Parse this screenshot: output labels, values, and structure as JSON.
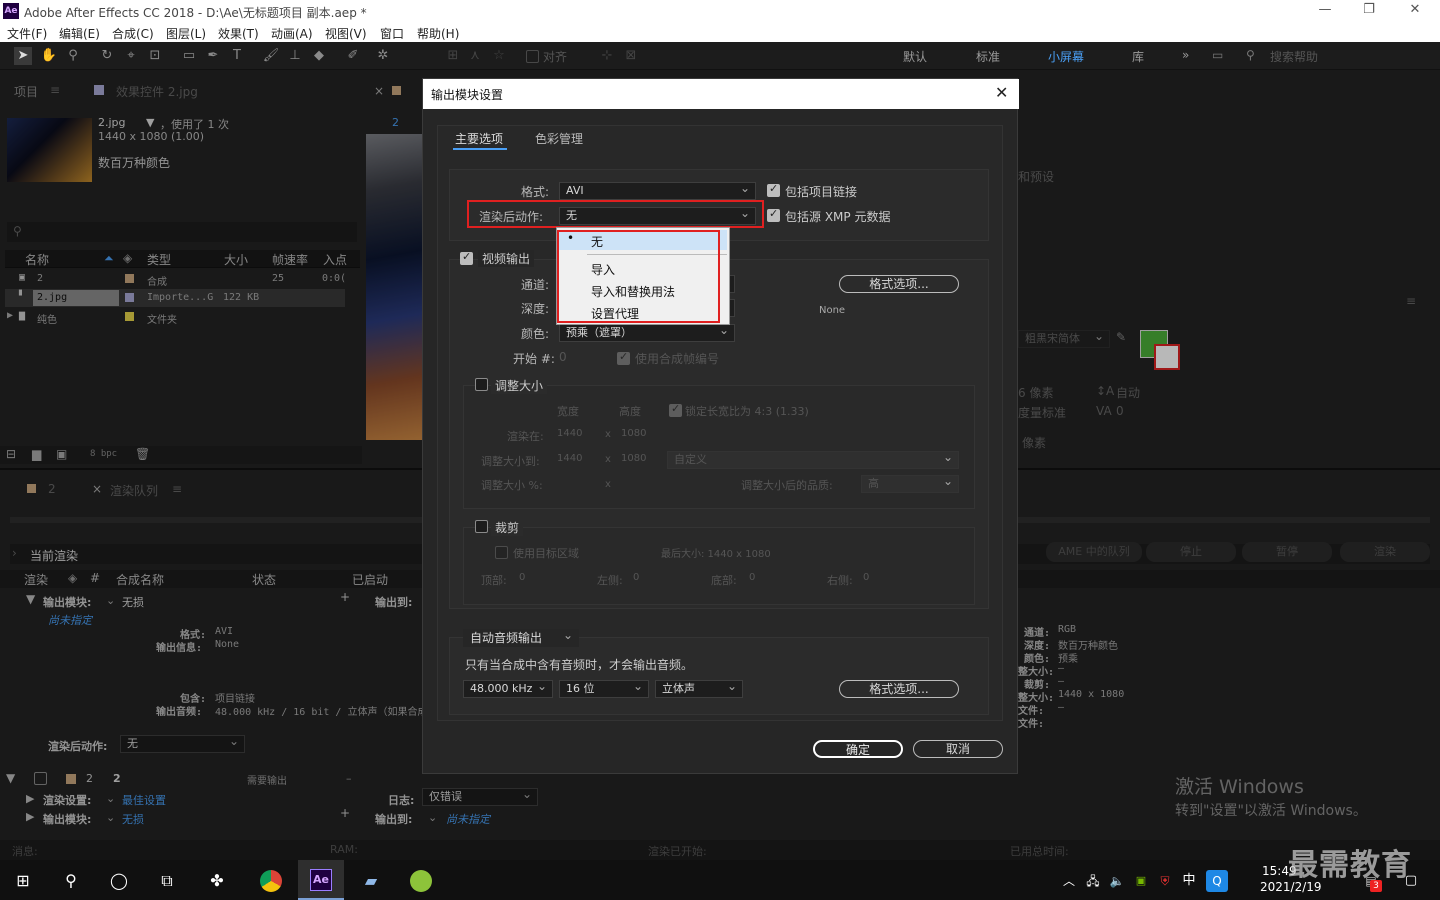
{
  "window": {
    "title": "Adobe After Effects CC 2018 - D:\\Ae\\无标题项目 副本.aep *",
    "app_icon": "Ae",
    "controls": [
      "—",
      "❐",
      "✕"
    ]
  },
  "menu": [
    "文件(F)",
    "编辑(E)",
    "合成(C)",
    "图层(L)",
    "效果(T)",
    "动画(A)",
    "视图(V)",
    "窗口",
    "帮助(H)"
  ],
  "toolbar": {
    "align_label": "对齐",
    "workspaces": [
      "默认",
      "标准",
      "小屏幕",
      "库"
    ],
    "active_workspace": "小屏幕",
    "search_placeholder": "搜索帮助",
    "more": "»"
  },
  "project_panel": {
    "tab_project": "项目",
    "tab_effects": "效果控件 2.jpg",
    "asset_name": "2.jpg",
    "asset_used": "，使用了 1 次",
    "asset_dims": "1440 x 1080 (1.00)",
    "asset_colors": "数百万种颜色",
    "columns": [
      "名称",
      "类型",
      "大小",
      "帧速率",
      "入点"
    ],
    "rows": [
      {
        "name": "2",
        "type": "合成",
        "size": "",
        "fps": "25",
        "in": "0:0("
      },
      {
        "name": "2.jpg",
        "type": "Importe...G",
        "size": "122 KB",
        "fps": "",
        "in": ""
      },
      {
        "name": "纯色",
        "type": "文件夹",
        "size": "",
        "fps": "",
        "in": ""
      }
    ],
    "bpc": "8 bpc"
  },
  "comp_panel": {
    "tab_num": "2"
  },
  "render_queue": {
    "tab_comp": "2",
    "tab_queue": "渲染队列",
    "current_render": "当前渲染",
    "columns": [
      "渲染",
      "#",
      "合成名称",
      "状态",
      "已启动"
    ],
    "output_module_label": "输出模块:",
    "output_module_value": "无损",
    "output_to_label": "输出到:",
    "not_specified": "尚未指定",
    "format_label": "格式:",
    "format_value": "AVI",
    "output_info_label": "输出信息:",
    "output_info_value": "None",
    "include_label": "包含:",
    "include_value": "项目链接",
    "audio_label": "输出音频:",
    "audio_value": "48.000 kHz / 16 bit / 立体声（如果合成",
    "post_render_label": "渲染后动作:",
    "post_render_value": "无",
    "item_num": "2",
    "item_name": "2",
    "item_status": "需要输出",
    "item_dash": "–",
    "render_settings_label": "渲染设置:",
    "render_settings_value": "最佳设置",
    "log_label": "日志:",
    "log_value": "仅错误",
    "output_module2_value": "无损",
    "output_to2_value": "尚未指定",
    "buttons": [
      "AME 中的队列",
      "停止",
      "暂停",
      "渲染"
    ],
    "right_info": [
      {
        "label": "通道:",
        "value": "RGB"
      },
      {
        "label": "深度:",
        "value": "数百万种颜色"
      },
      {
        "label": "颜色:",
        "value": "预乘"
      },
      {
        "label": "整大小:",
        "value": "–"
      },
      {
        "label": "裁剪:",
        "value": "–"
      },
      {
        "label": "整大小:",
        "value": "1440 x 1080"
      },
      {
        "label": "文件:",
        "value": "–"
      },
      {
        "label": "文件:",
        "value": ""
      }
    ]
  },
  "right_panel": {
    "presets": "和预设",
    "font": "粗黑宋简体",
    "px": "6 像素",
    "auto": "自动",
    "metric": "度量标准",
    "zero": "0",
    "px2": "像素"
  },
  "status_bar": {
    "msg": "消息:",
    "ram": "RAM:",
    "started": "渲染已开始:",
    "total": "已用总时间:"
  },
  "watermark": {
    "line1": "激活 Windows",
    "line2": "转到\"设置\"以激活 Windows。",
    "logo": "最需教育"
  },
  "dialog": {
    "title": "输出模块设置",
    "tabs": [
      "主要选项",
      "色彩管理"
    ],
    "format_label": "格式:",
    "format_value": "AVI",
    "include_link": "包括项目链接",
    "post_label": "渲染后动作:",
    "post_value": "无",
    "include_xmp": "包括源 XMP 元数据",
    "video_output": "视频输出",
    "channel_label": "通道:",
    "depth_label": "深度:",
    "color_label": "颜色:",
    "color_value": "预乘（遮罩）",
    "format_options": "格式选项...",
    "none_text": "None",
    "start_label": "开始 #:",
    "start_value": "0",
    "use_comp_frame": "使用合成帧编号",
    "resize": "调整大小",
    "width_label": "宽度",
    "height_label": "高度",
    "lock_ratio": "锁定长宽比为 4:3 (1.33)",
    "render_at_label": "渲染在:",
    "render_w": "1440",
    "render_h": "1080",
    "resize_to_label": "调整大小到:",
    "resize_w": "1440",
    "resize_h": "1080",
    "custom": "自定义",
    "resize_pct_label": "调整大小 %:",
    "quality_label": "调整大小后的品质:",
    "quality_value": "高",
    "crop": "裁剪",
    "use_roi": "使用目标区域",
    "final_size": "最后大小: 1440 x 1080",
    "top_label": "顶部:",
    "left_label": "左侧:",
    "bottom_label": "底部:",
    "right_label": "右侧:",
    "zero": "0",
    "x": "x",
    "audio_mode": "自动音频输出",
    "audio_note": "只有当合成中含有音频时，才会输出音频。",
    "sample_rate": "48.000 kHz",
    "bits": "16 位",
    "stereo": "立体声",
    "audio_format_options": "格式选项...",
    "ok": "确定",
    "cancel": "取消",
    "popup_items": [
      "无",
      "导入",
      "导入和替换用法",
      "设置代理"
    ],
    "popup_selected": "无"
  },
  "taskbar": {
    "time": "15:49",
    "date": "2021/2/19",
    "ime": "中",
    "notif_count": "3",
    "ae_label": "Ae"
  }
}
